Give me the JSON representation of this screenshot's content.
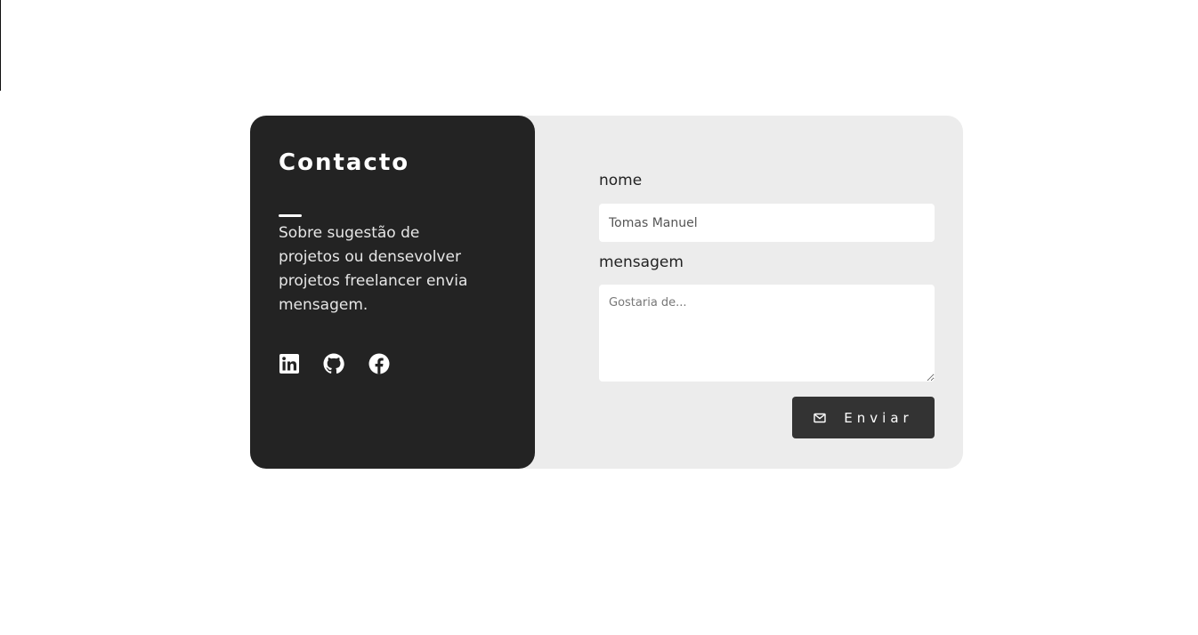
{
  "contact": {
    "title": "Contacto",
    "description": "Sobre sugestão de projetos ou densevolver projetos freelancer envia mensagem.",
    "social": [
      {
        "name": "linkedin",
        "icon": "linkedin-icon"
      },
      {
        "name": "github",
        "icon": "github-icon"
      },
      {
        "name": "facebook",
        "icon": "facebook-icon"
      }
    ]
  },
  "form": {
    "name_label": "nome",
    "name_value": "Tomas Manuel",
    "message_label": "mensagem",
    "message_placeholder": "Gostaria de...",
    "message_value": "",
    "submit_label": "Enviar",
    "submit_icon": "envelope-icon"
  },
  "colors": {
    "page_background": "#ffffff",
    "card_background": "#ececec",
    "info_panel": "#232323",
    "button": "#333333",
    "text_light": "#ffffff",
    "text_dark": "#222222"
  }
}
